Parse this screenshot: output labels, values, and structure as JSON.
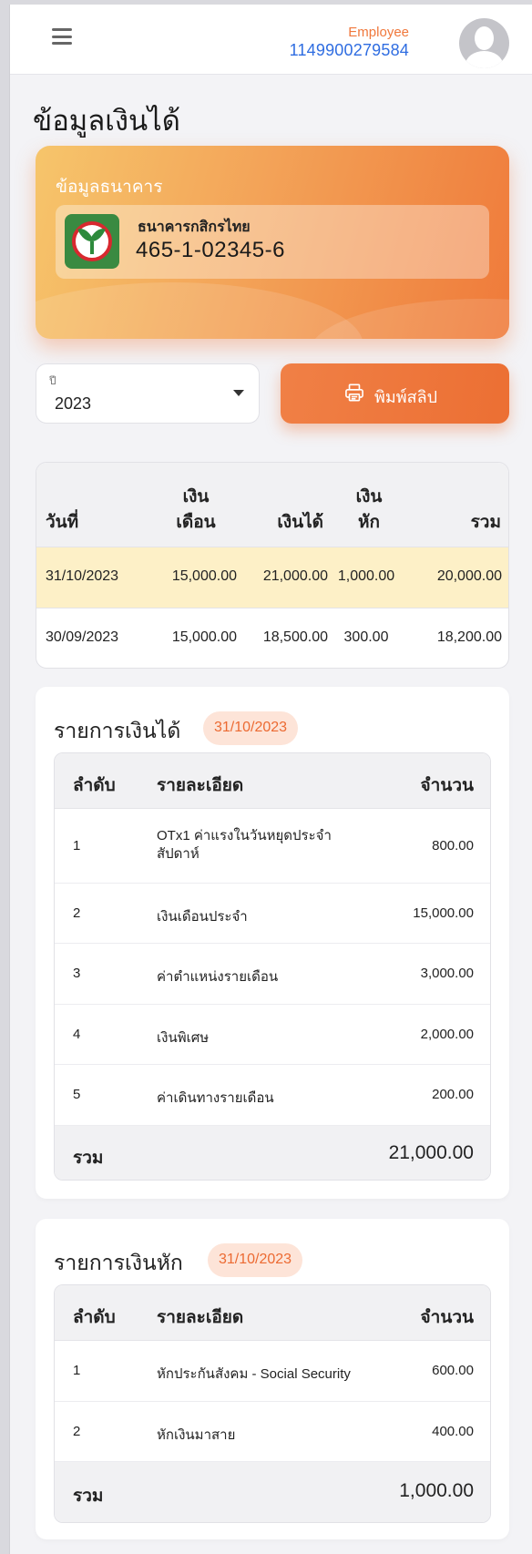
{
  "header": {
    "role": "Employee",
    "employee_id": "1149900279584"
  },
  "page_title": "ข้อมูลเงินได้",
  "bank_card": {
    "title": "ข้อมูลธนาคาร",
    "bank_name": "ธนาคารกสิกรไทย",
    "account_number": "465-1-02345-6"
  },
  "year_select": {
    "label": "ปี",
    "value": "2023"
  },
  "print_button": {
    "label": "พิมพ์สลิป"
  },
  "summary_table": {
    "headers": {
      "date": "วันที่",
      "salary_line1": "เงิน",
      "salary_line2": "เดือน",
      "income": "เงินได้",
      "deduct_line1": "เงิน",
      "deduct_line2": "หัก",
      "total": "รวม"
    },
    "rows": [
      {
        "date": "31/10/2023",
        "salary": "15,000.00",
        "income": "21,000.00",
        "deduct": "1,000.00",
        "total": "20,000.00"
      },
      {
        "date": "30/09/2023",
        "salary": "15,000.00",
        "income": "18,500.00",
        "deduct": "300.00",
        "total": "18,200.00"
      }
    ]
  },
  "income_section": {
    "title": "รายการเงินได้",
    "date": "31/10/2023",
    "headers": {
      "no": "ลำดับ",
      "detail": "รายละเอียด",
      "amount": "จำนวน"
    },
    "rows": [
      {
        "no": "1",
        "detail": "OTx1 ค่าแรงในวันหยุดประจำสัปดาห์",
        "amount": "800.00"
      },
      {
        "no": "2",
        "detail": "เงินเดือนประจำ",
        "amount": "15,000.00"
      },
      {
        "no": "3",
        "detail": "ค่าตำแหน่งรายเดือน",
        "amount": "3,000.00"
      },
      {
        "no": "4",
        "detail": "เงินพิเศษ",
        "amount": "2,000.00"
      },
      {
        "no": "5",
        "detail": "ค่าเดินทางรายเดือน",
        "amount": "200.00"
      }
    ],
    "total_label": "รวม",
    "total_value": "21,000.00"
  },
  "deduction_section": {
    "title": "รายการเงินหัก",
    "date": "31/10/2023",
    "headers": {
      "no": "ลำดับ",
      "detail": "รายละเอียด",
      "amount": "จำนวน"
    },
    "rows": [
      {
        "no": "1",
        "detail": "หักประกันสังคม - Social Security",
        "amount": "600.00"
      },
      {
        "no": "2",
        "detail": "หักเงินมาสาย",
        "amount": "400.00"
      }
    ],
    "total_label": "รวม",
    "total_value": "1,000.00"
  }
}
